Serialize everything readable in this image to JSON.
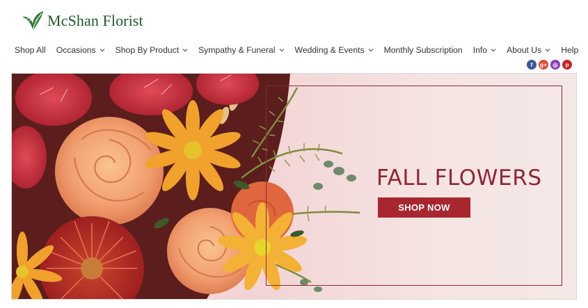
{
  "header": {
    "logo_text": "McShan Florist",
    "logo_icon": "leaf-logo-icon"
  },
  "nav": {
    "items": [
      {
        "label": "Shop All",
        "has_dropdown": false
      },
      {
        "label": "Occasions",
        "has_dropdown": true
      },
      {
        "label": "Shop By Product",
        "has_dropdown": true
      },
      {
        "label": "Sympathy & Funeral",
        "has_dropdown": true
      },
      {
        "label": "Wedding & Events",
        "has_dropdown": true
      },
      {
        "label": "Monthly Subscription",
        "has_dropdown": false
      },
      {
        "label": "Info",
        "has_dropdown": true
      },
      {
        "label": "About Us",
        "has_dropdown": true
      },
      {
        "label": "Help",
        "has_dropdown": false
      }
    ]
  },
  "social": [
    {
      "name": "facebook-icon",
      "glyph": "f",
      "color": "#3b5998"
    },
    {
      "name": "google-plus-icon",
      "glyph": "g+",
      "color": "#dd4b39"
    },
    {
      "name": "instagram-icon",
      "glyph": "◎",
      "color": "#8a3ab9"
    },
    {
      "name": "pinterest-icon",
      "glyph": "p",
      "color": "#cb2027"
    }
  ],
  "hero": {
    "headline": "FALL FLOWERS",
    "cta_label": "SHOP NOW",
    "colors": {
      "headline": "#8e2735",
      "cta_bg": "#a8262f",
      "frame": "#8e2b36",
      "background": "#f6d2d4"
    }
  }
}
